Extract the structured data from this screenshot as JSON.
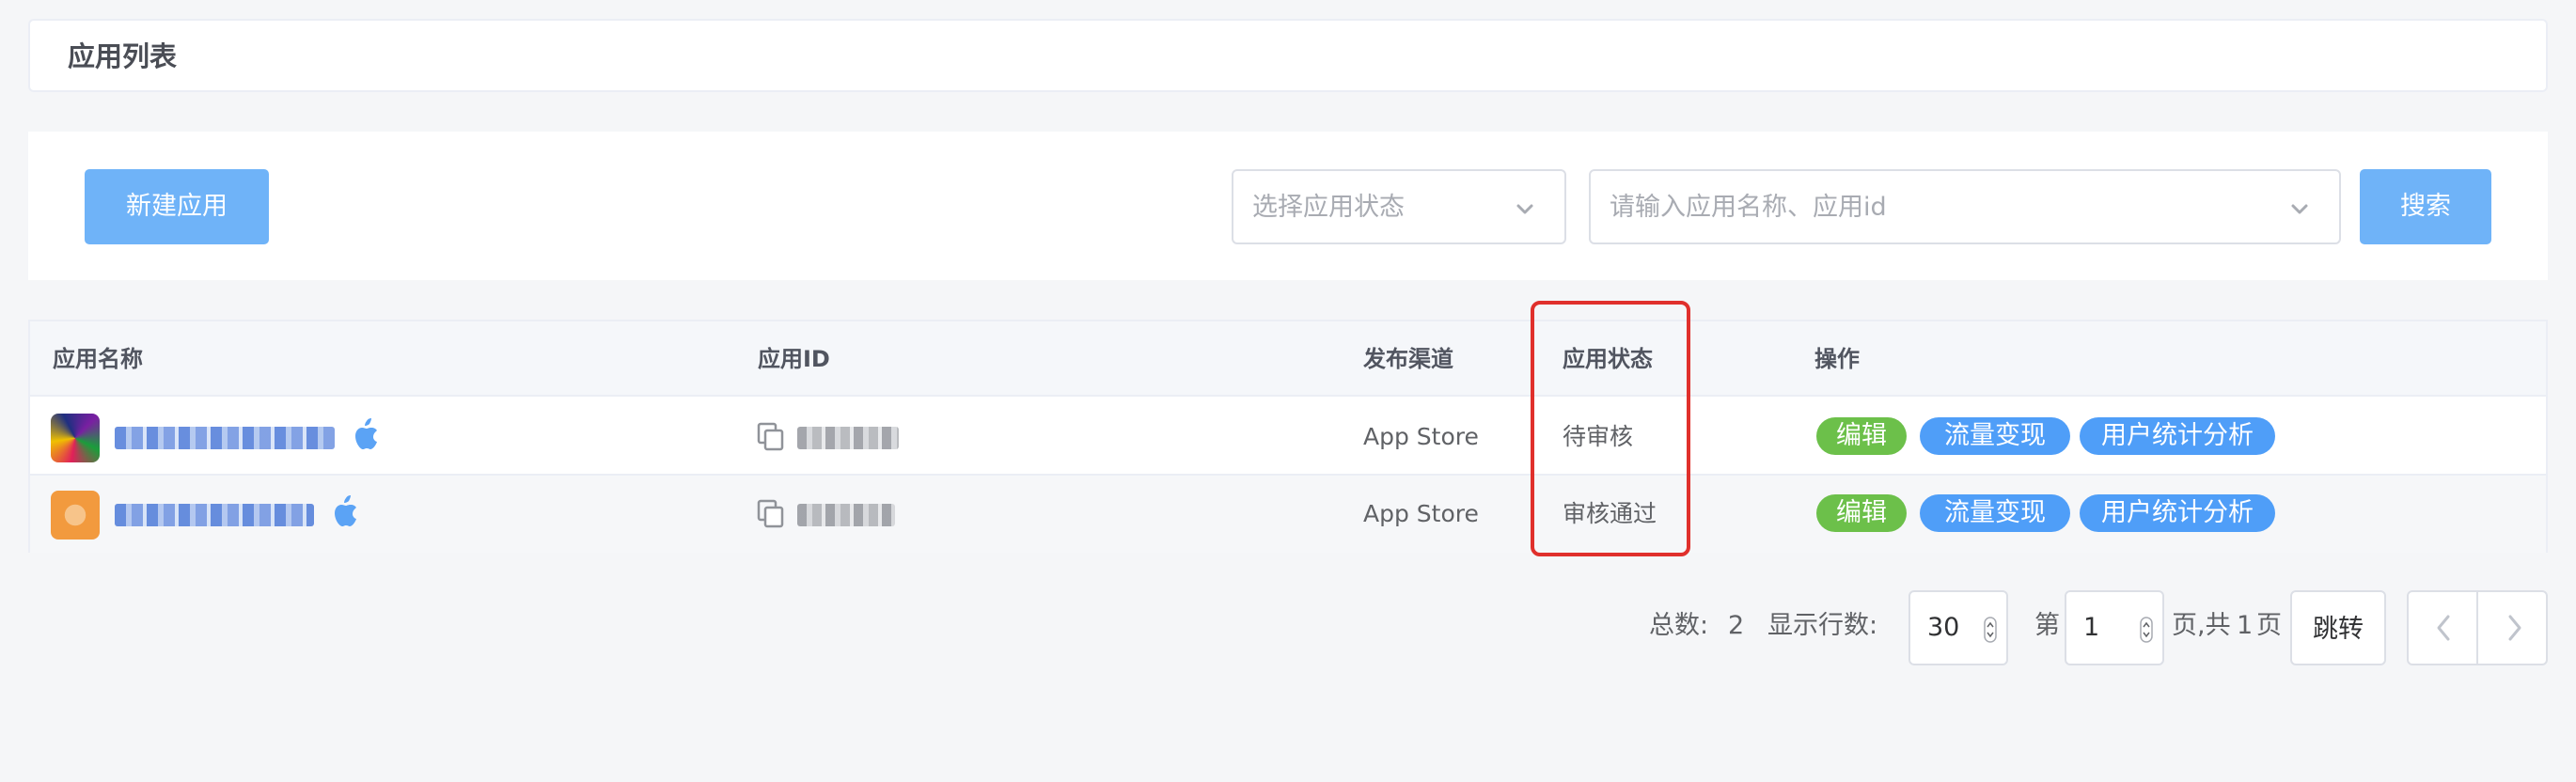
{
  "header": {
    "title": "应用列表"
  },
  "toolbar": {
    "new_app_label": "新建应用",
    "status_placeholder": "选择应用状态",
    "keyword_placeholder": "请输入应用名称、应用id",
    "search_label": "搜索"
  },
  "table": {
    "columns": [
      "应用名称",
      "应用ID",
      "发布渠道",
      "应用状态",
      "操作"
    ],
    "rows": [
      {
        "name": "(redacted)",
        "app_id": "(redacted)",
        "channel": "App Store",
        "status": "待审核",
        "actions": [
          "编辑",
          "流量变现",
          "用户统计分析"
        ]
      },
      {
        "name": "(redacted)",
        "app_id": "(redacted)",
        "channel": "App Store",
        "status": "审核通过",
        "actions": [
          "编辑",
          "流量变现",
          "用户统计分析"
        ]
      }
    ]
  },
  "pagination": {
    "total_label": "总数:",
    "total": "2",
    "rows_label": "显示行数:",
    "rows_value": "30",
    "page_prefix": "第",
    "page_value": "1",
    "page_suffix": "页,共",
    "page_total": "1",
    "page_unit": "页",
    "jump_label": "跳转"
  },
  "colors": {
    "primary": "#6fb3f8",
    "tag_green": "#6cc04a",
    "tag_blue": "#4f9ef8",
    "highlight": "#e0302c"
  },
  "icons": [
    "chevron-down-icon",
    "apple-icon",
    "copy-icon",
    "chevron-left-icon",
    "chevron-right-icon",
    "spinner-icon"
  ]
}
